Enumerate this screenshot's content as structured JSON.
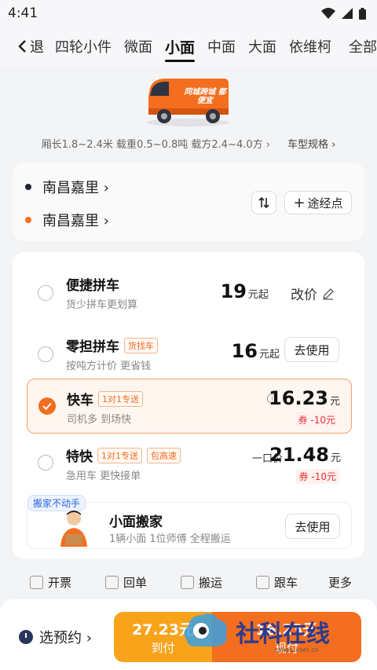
{
  "status": {
    "time": "4:41"
  },
  "nav": {
    "back_label": "退",
    "tabs": [
      "四轮小件",
      "微面",
      "小面",
      "中面",
      "大面",
      "依维柯",
      "全部"
    ],
    "active_index": 2
  },
  "vehicle": {
    "banner_text": "同城跨城 都便宜",
    "specs": "厢长1.8~2.4米 载重0.5~0.8吨 载方2.4~4.0方 ›",
    "specs_link": "车型规格 ›"
  },
  "route": {
    "from": "南昌嘉里 ›",
    "to": "南昌嘉里 ›",
    "swap_icon": "swap-icon",
    "waypoint_label": "途经点"
  },
  "options": [
    {
      "title": "便捷拼车",
      "sub": "货少拼车更划算",
      "price": "19",
      "unit": "元起",
      "action": "改价"
    },
    {
      "title": "零担拼车",
      "tag": "货找车",
      "sub": "按吨方计价 更省钱",
      "price": "16",
      "unit": "元起",
      "action": "去使用"
    },
    {
      "title": "快车",
      "tag": "1对1专送",
      "sub": "司机多 到场快",
      "price": "16.23",
      "unit": "元",
      "coupon": "券 -10元",
      "selected": true
    },
    {
      "title": "特快",
      "tag": "1对1专送",
      "tag2": "包高速",
      "sub": "急用车 更快接单",
      "price_prefix": "一口价",
      "price": "21.48",
      "unit": "元",
      "coupon": "券 -10元"
    }
  ],
  "moving": {
    "tag": "搬家不动手",
    "title": "小面搬家",
    "sub": "1辆小面 1位师傅 全程搬运",
    "action": "去使用"
  },
  "filters": [
    "开票",
    "回单",
    "搬运",
    "跟车"
  ],
  "filters_more": "更多",
  "bottom": {
    "reserve_label": "选预约 ›",
    "left_amount": "27.23元",
    "left_label": "到付",
    "right_amount": "16.23元",
    "right_label": "现付"
  },
  "watermark": {
    "text": "社科在线",
    "url": "sskeis.com.cn"
  },
  "colors": {
    "accent": "#f36e1f",
    "accent_light": "#f9a31b",
    "coupon": "#e33333"
  }
}
